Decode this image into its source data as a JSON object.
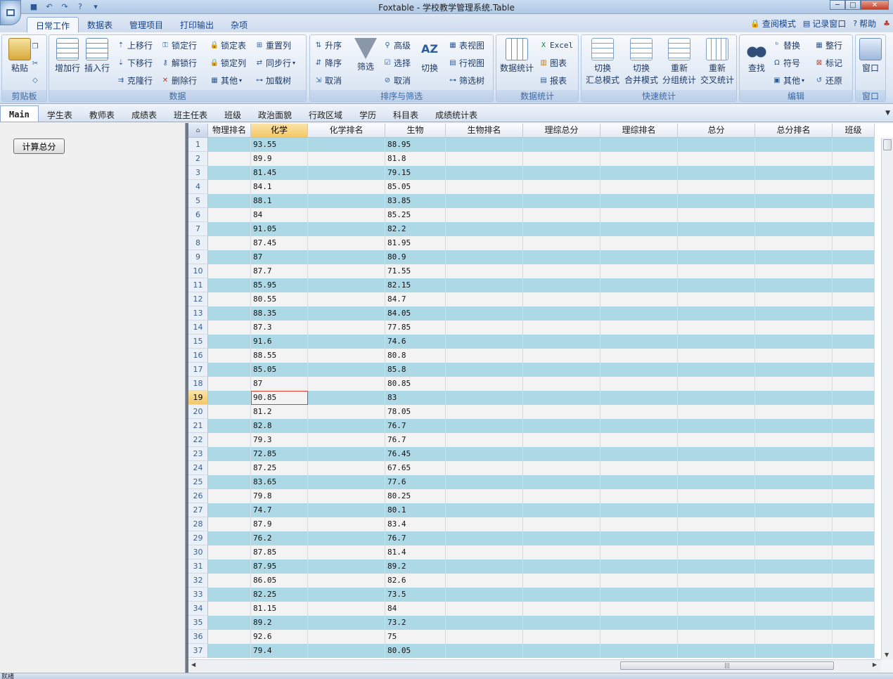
{
  "window": {
    "title": "Foxtable - 学校教学管理系统.Table"
  },
  "ribbon_tabs": [
    {
      "label": "日常工作",
      "active": true
    },
    {
      "label": "数据表"
    },
    {
      "label": "管理项目"
    },
    {
      "label": "打印输出"
    },
    {
      "label": "杂项"
    }
  ],
  "right_links": {
    "view_mode": "查阅模式",
    "record_window": "记录窗口",
    "help": "帮助"
  },
  "groups": {
    "clipboard": {
      "label": "剪贴板",
      "paste": "粘贴"
    },
    "data": {
      "label": "数据",
      "add_row": "增加行",
      "insert_row": "插入行",
      "move_up": "上移行",
      "move_down": "下移行",
      "clone_row": "克隆行",
      "lock_row": "锁定行",
      "unlock_row": "解锁行",
      "delete_row": "删除行",
      "lock_table": "锁定表",
      "lock_col": "锁定列",
      "other": "其他",
      "reset_col": "重置列",
      "sync_row": "同步行",
      "load_tree": "加载树"
    },
    "sort": {
      "label": "排序与筛选",
      "asc": "升序",
      "desc": "降序",
      "cancel": "取消",
      "filter": "筛选",
      "advanced": "高级",
      "select": "选择",
      "cancel2": "取消",
      "switch": "切换",
      "table_view": "表视图",
      "row_view": "行视图",
      "filter_tree": "筛选树"
    },
    "stats": {
      "label": "数据统计",
      "data_stats": "数据统计",
      "excel": "Excel",
      "chart": "图表",
      "report": "报表"
    },
    "quick": {
      "label": "快速统计",
      "b1a": "切换",
      "b1b": "汇总模式",
      "b2a": "切换",
      "b2b": "合并模式",
      "b3a": "重新",
      "b3b": "分组统计",
      "b4a": "重新",
      "b4b": "交叉统计"
    },
    "edit": {
      "label": "编辑",
      "find": "查找",
      "replace": "替换",
      "symbol": "符号",
      "other": "其他",
      "tidy": "整行",
      "mark": "标记",
      "restore": "还原"
    },
    "window": {
      "label": "窗口",
      "window": "窗口"
    }
  },
  "doc_tabs": [
    {
      "label": "Main",
      "active": true
    },
    {
      "label": "学生表"
    },
    {
      "label": "教师表"
    },
    {
      "label": "成绩表"
    },
    {
      "label": "班主任表"
    },
    {
      "label": "班级"
    },
    {
      "label": "政治面貌"
    },
    {
      "label": "行政区域"
    },
    {
      "label": "学历"
    },
    {
      "label": "科目表"
    },
    {
      "label": "成绩统计表"
    }
  ],
  "left_panel": {
    "calc_button": "计算总分"
  },
  "grid": {
    "columns": [
      "物理排名",
      "化学",
      "化学排名",
      "生物",
      "生物排名",
      "理综总分",
      "理综排名",
      "总分",
      "总分排名",
      "班级"
    ],
    "selected_column": "化学",
    "current_row": 19,
    "rows": [
      [
        1,
        "93.55",
        "88.95"
      ],
      [
        2,
        "89.9",
        "81.8"
      ],
      [
        3,
        "81.45",
        "79.15"
      ],
      [
        4,
        "84.1",
        "85.05"
      ],
      [
        5,
        "88.1",
        "83.85"
      ],
      [
        6,
        "84",
        "85.25"
      ],
      [
        7,
        "91.05",
        "82.2"
      ],
      [
        8,
        "87.45",
        "81.95"
      ],
      [
        9,
        "87",
        "80.9"
      ],
      [
        10,
        "87.7",
        "71.55"
      ],
      [
        11,
        "85.95",
        "82.15"
      ],
      [
        12,
        "80.55",
        "84.7"
      ],
      [
        13,
        "88.35",
        "84.05"
      ],
      [
        14,
        "87.3",
        "77.85"
      ],
      [
        15,
        "91.6",
        "74.6"
      ],
      [
        16,
        "88.55",
        "80.8"
      ],
      [
        17,
        "85.05",
        "85.8"
      ],
      [
        18,
        "87",
        "80.85"
      ],
      [
        19,
        "90.85",
        "83"
      ],
      [
        20,
        "81.2",
        "78.05"
      ],
      [
        21,
        "82.8",
        "76.7"
      ],
      [
        22,
        "79.3",
        "76.7"
      ],
      [
        23,
        "72.85",
        "76.45"
      ],
      [
        24,
        "87.25",
        "67.65"
      ],
      [
        25,
        "83.65",
        "77.6"
      ],
      [
        26,
        "79.8",
        "80.25"
      ],
      [
        27,
        "74.7",
        "80.1"
      ],
      [
        28,
        "87.9",
        "83.4"
      ],
      [
        29,
        "76.2",
        "76.7"
      ],
      [
        30,
        "87.85",
        "81.4"
      ],
      [
        31,
        "87.95",
        "89.2"
      ],
      [
        32,
        "86.05",
        "82.6"
      ],
      [
        33,
        "82.25",
        "73.5"
      ],
      [
        34,
        "81.15",
        "84"
      ],
      [
        35,
        "89.2",
        "73.2"
      ],
      [
        36,
        "92.6",
        "75"
      ],
      [
        37,
        "79.4",
        "80.05"
      ]
    ]
  },
  "status": {
    "text": "就绪"
  },
  "colors": {
    "row_odd": "#add8e6",
    "row_even": "#f3f3f3",
    "ribbon_text": "#15428b",
    "focus_border": "#e53e2e"
  }
}
